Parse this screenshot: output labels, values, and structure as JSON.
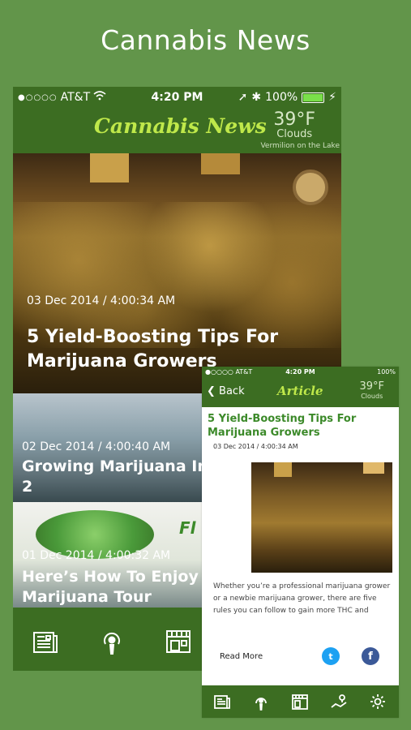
{
  "promo": {
    "title": "Cannabis News"
  },
  "status_large": {
    "carrier": "AT&T",
    "signal": "●○○○○",
    "time": "4:20 PM",
    "battery": "100%"
  },
  "status_small": {
    "carrier": "●○○○○ AT&T",
    "time": "4:20 PM",
    "battery": "100%"
  },
  "app_large": {
    "brand": "Cannabis News",
    "weather": {
      "temp": "39°F",
      "condition": "Clouds",
      "location": "Vermilion on the Lake"
    }
  },
  "feed": [
    {
      "date": "03 Dec 2014 / 4:00:34 AM",
      "title": "5 Yield-Boosting Tips For Marijuana Growers"
    },
    {
      "date": "02 Dec 2014 / 4:00:40 AM",
      "title": "Growing Marijuana In Part 2"
    },
    {
      "date": "01 Dec 2014 / 4:00:32 AM",
      "title": "Here’s How To Enjoy A Marijuana Tour"
    }
  ],
  "feed_overlay": {
    "card3_logo_text": "Fl"
  },
  "tabs": [
    "news-icon",
    "podcast-icon",
    "dispensary-icon",
    "map-icon",
    "settings-icon"
  ],
  "article": {
    "back_label": "Back",
    "header_title": "Article",
    "weather": {
      "temp": "39°F",
      "condition": "Clouds"
    },
    "title": "5 Yield-Boosting Tips For Marijuana Growers",
    "date": "03 Dec 2014 / 4:00:34 AM",
    "excerpt": "Whether you’re a professional marijuana grower or a newbie marijuana grower, there are five rules you can follow to gain more THC and",
    "read_more": "Read More",
    "twitter_glyph": "t",
    "facebook_glyph": "f"
  },
  "colors": {
    "background": "#62954a",
    "app_green": "#3c6d22",
    "brand_yellow": "#bfe84a",
    "article_title": "#3c8a2a"
  }
}
